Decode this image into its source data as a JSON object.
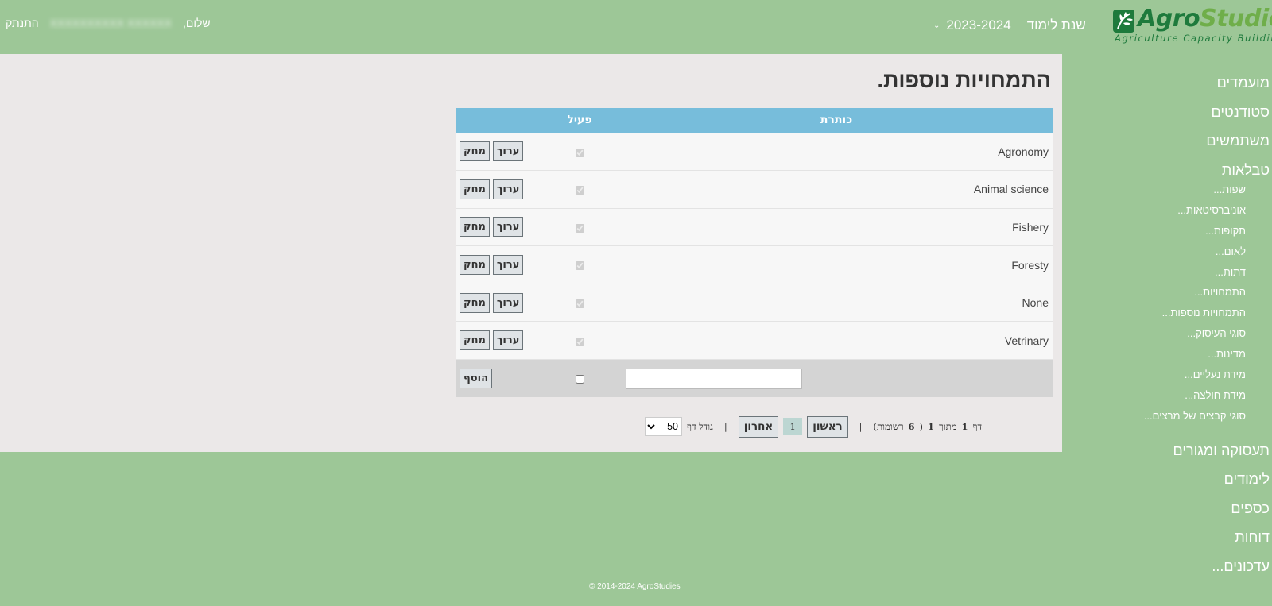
{
  "header": {
    "logo": {
      "brand_part1": "Agro",
      "brand_part2": "Studies",
      "tagline": "Agriculture Capacity Building"
    },
    "year_selector": {
      "label": "שנת לימוד",
      "value": "2023-2024"
    },
    "user": {
      "greeting": "שלום,",
      "name": "XXXXXXXXXX XXXXXX",
      "logout": "התנתק"
    }
  },
  "page": {
    "title": "התמחויות נוספות."
  },
  "table": {
    "headers": {
      "title": "כותרת",
      "active": "פעיל"
    },
    "rows": [
      {
        "title": "Agronomy",
        "active": true
      },
      {
        "title": "Animal science",
        "active": true
      },
      {
        "title": "Fishery",
        "active": true
      },
      {
        "title": "Foresty",
        "active": true
      },
      {
        "title": "None",
        "active": true
      },
      {
        "title": "Vetrinary",
        "active": true
      }
    ],
    "edit_label": "ערוך",
    "delete_label": "מחק",
    "add_label": "הוסף"
  },
  "pager": {
    "page_word": "דף",
    "page_current": "1",
    "of_word": "מתוך",
    "page_total": "1",
    "records_open": "(",
    "records_count": "6",
    "records_word": "רשומות)",
    "first_label": "ראשון",
    "current_page": "1",
    "last_label": "אחרון",
    "page_size_label": "גודל דף",
    "page_size_value": "50"
  },
  "sidebar": {
    "items_top": [
      "מועמדים",
      "סטודנטים",
      "משתמשים",
      "טבלאות"
    ],
    "items_sub": [
      "שפות...",
      "אוניברסיטאות...",
      "תקופות...",
      "לאום...",
      "דתות...",
      "התמחויות...",
      "התמחויות נוספות...",
      "סוגי העיסוק...",
      "מדינות...",
      "מידת נעליים...",
      "מידת חולצה...",
      "סוגי קבצים של מרצים..."
    ],
    "items_bottom": [
      "תעסוקה ומגורים",
      "לימודים",
      "כספים",
      "דוחות",
      "עדכונים..."
    ]
  },
  "footer": {
    "copyright": "© 2014-2024 AgroStudies"
  },
  "colors": {
    "background": "#9dc797",
    "panel": "#ebe8e8",
    "table_header": "#77bddb",
    "brand_green": "#1e7a3c"
  }
}
